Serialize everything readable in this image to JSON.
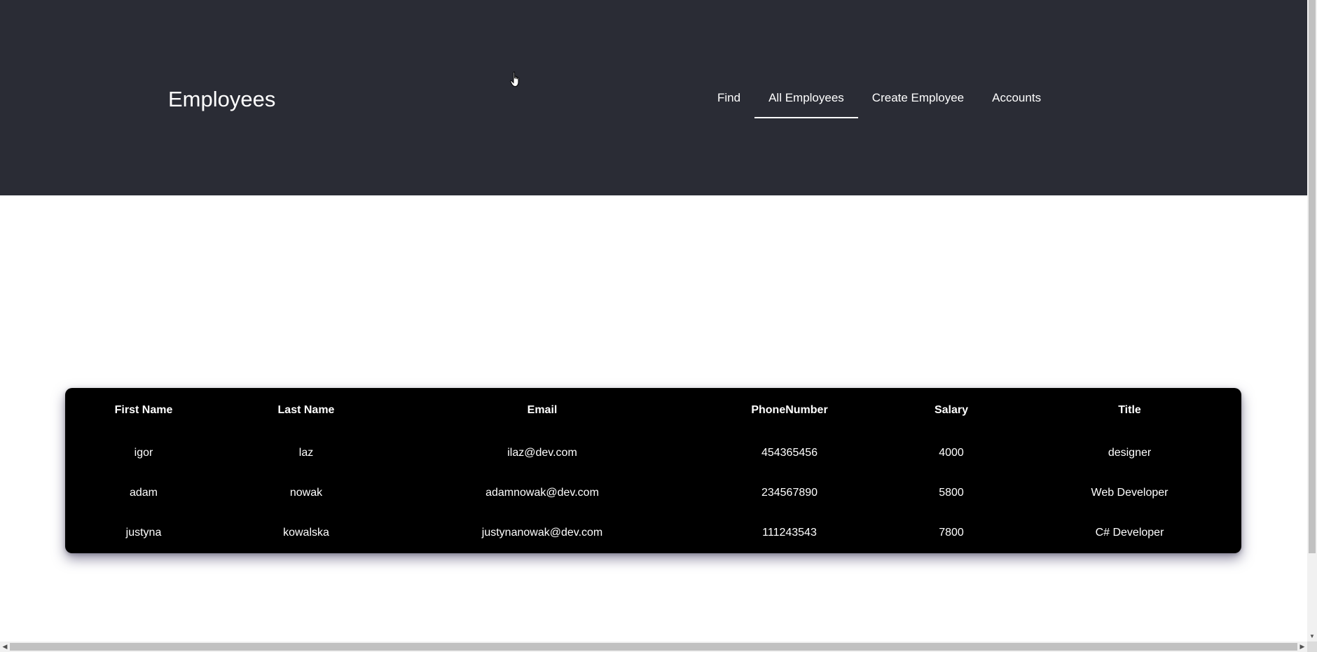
{
  "header": {
    "title": "Employees",
    "nav": [
      {
        "label": "Find",
        "active": false
      },
      {
        "label": "All Employees",
        "active": true
      },
      {
        "label": "Create Employee",
        "active": false
      },
      {
        "label": "Accounts",
        "active": false
      }
    ]
  },
  "table": {
    "columns": [
      "First Name",
      "Last Name",
      "Email",
      "PhoneNumber",
      "Salary",
      "Title"
    ],
    "rows": [
      [
        "igor",
        "laz",
        "ilaz@dev.com",
        "454365456",
        "4000",
        "designer"
      ],
      [
        "adam",
        "nowak",
        "adamnowak@dev.com",
        "234567890",
        "5800",
        "Web Developer"
      ],
      [
        "justyna",
        "kowalska",
        "justynanowak@dev.com",
        "111243543",
        "7800",
        "C# Developer"
      ]
    ]
  },
  "colors": {
    "header_bg": "#2a2c35",
    "table_bg": "#000000",
    "text": "#ffffff",
    "page_bg": "#ffffff"
  },
  "icons": {
    "cursor": "hand-pointer-icon",
    "scroll_left": "chevron-left-icon",
    "scroll_right": "chevron-right-icon",
    "scroll_down": "chevron-down-icon"
  }
}
